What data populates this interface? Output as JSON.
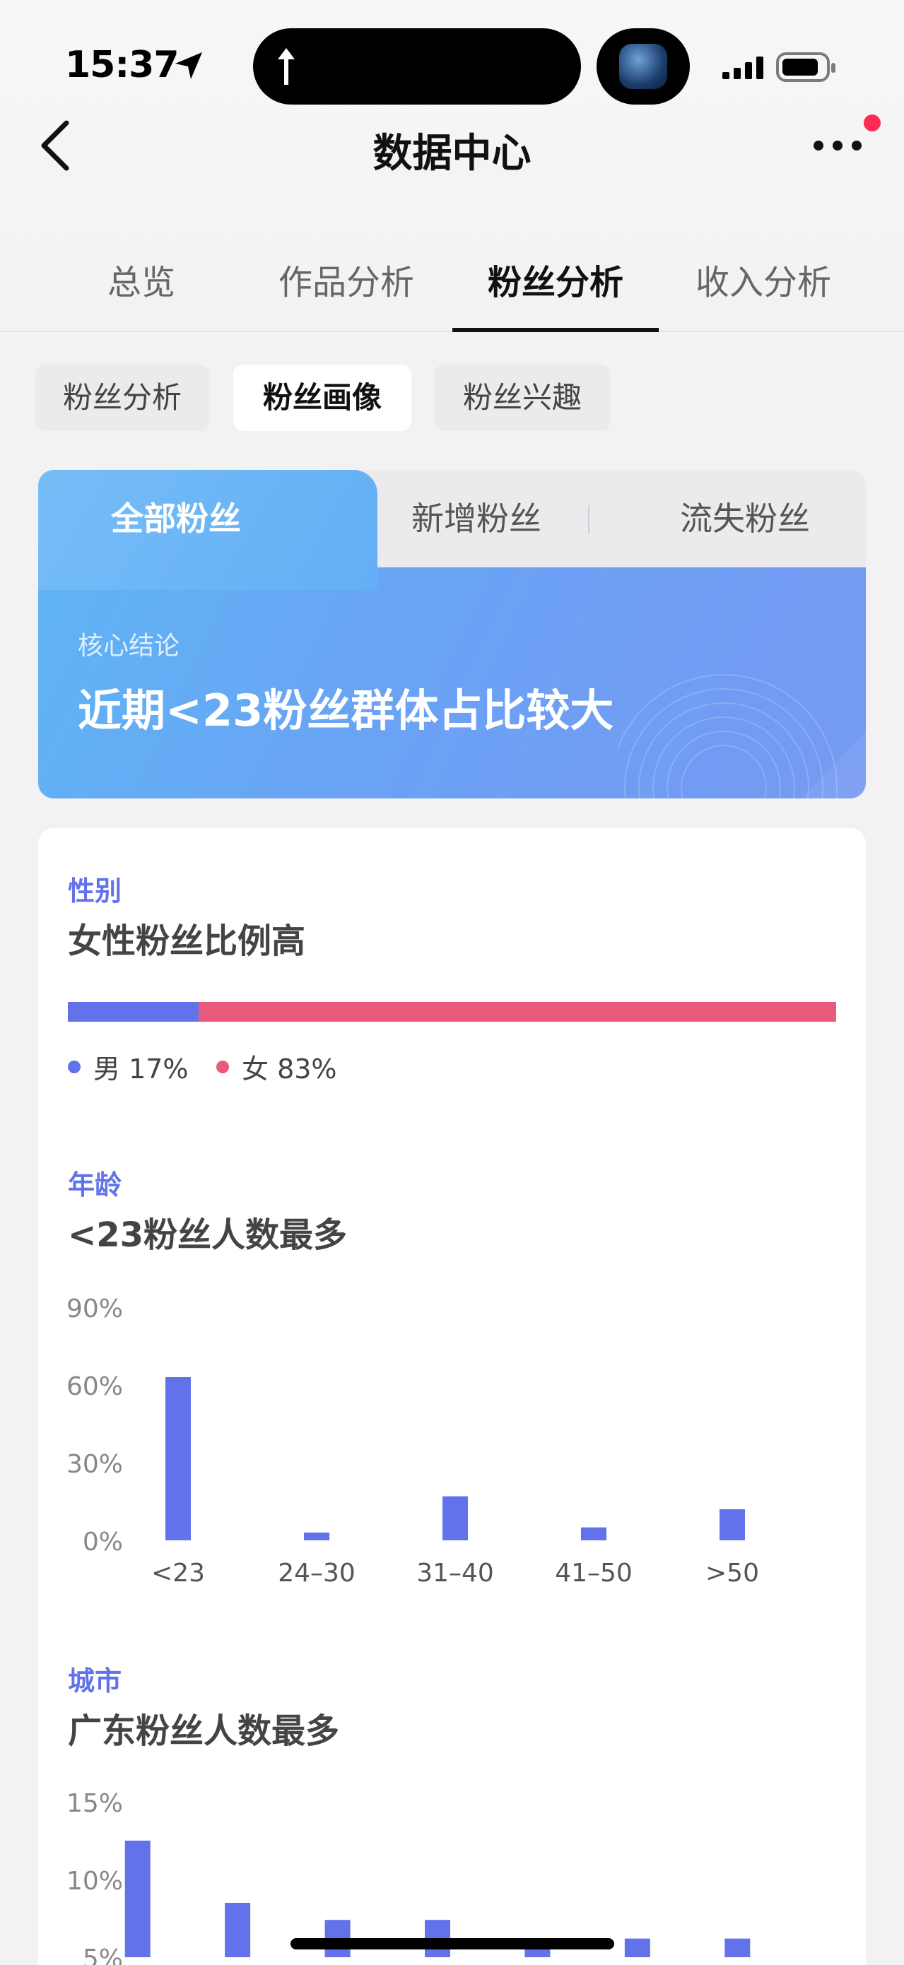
{
  "status": {
    "time": "15:37"
  },
  "header": {
    "title": "数据中心"
  },
  "main_tabs": [
    {
      "label": "总览"
    },
    {
      "label": "作品分析"
    },
    {
      "label": "粉丝分析",
      "active": true
    },
    {
      "label": "收入分析"
    }
  ],
  "sub_tabs": [
    {
      "label": "粉丝分析"
    },
    {
      "label": "粉丝画像",
      "active": true
    },
    {
      "label": "粉丝兴趣"
    }
  ],
  "fan_type_tabs": [
    {
      "label": "全部粉丝",
      "active": true
    },
    {
      "label": "新增粉丝"
    },
    {
      "label": "流失粉丝"
    }
  ],
  "core": {
    "label": "核心结论",
    "conclusion": "近期<23粉丝群体占比较大"
  },
  "gender": {
    "label": "性别",
    "title": "女性粉丝比例高",
    "male": {
      "label": "男 17%",
      "share": 17,
      "color": "#6272ea"
    },
    "female": {
      "label": "女 83%",
      "share": 83,
      "color": "#ea5a7c"
    }
  },
  "age": {
    "label": "年龄",
    "title": "<23粉丝人数最多"
  },
  "city": {
    "label": "城市",
    "title": "广东粉丝人数最多"
  },
  "chart_data": [
    {
      "type": "bar",
      "categories": [
        "<23",
        "24–30",
        "31–40",
        "41–50",
        ">50"
      ],
      "values": [
        63,
        3,
        17,
        5,
        12
      ],
      "yticks": [
        "0%",
        "30%",
        "60%",
        "90%"
      ],
      "ylim": [
        0,
        90
      ],
      "color": "#6272ea",
      "grid": false
    },
    {
      "type": "bar",
      "categories": [
        "",
        "",
        "",
        "",
        "",
        "",
        ""
      ],
      "values": [
        12.5,
        8.5,
        7.4,
        7.4,
        6.0,
        6.2,
        6.2
      ],
      "yticks": [
        "5%",
        "10%",
        "15%"
      ],
      "ylim": [
        5,
        15
      ],
      "color": "#6272ea",
      "grid": false
    }
  ]
}
